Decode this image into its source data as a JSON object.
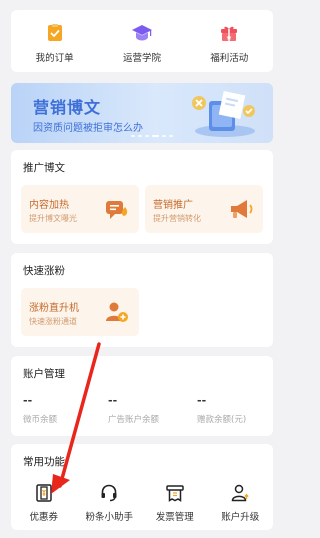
{
  "quick_links": [
    {
      "label": "我的订单",
      "icon": "order-check-icon",
      "color": "#f5a623"
    },
    {
      "label": "运营学院",
      "icon": "graduation-cap-icon",
      "color": "#7c5cf0"
    },
    {
      "label": "福利活动",
      "icon": "gift-box-icon",
      "color": "#f0505a"
    }
  ],
  "banner": {
    "title": "营销博文",
    "subtitle": "因资质问题被拒审怎么办"
  },
  "promote": {
    "title": "推广博文",
    "tiles": [
      {
        "title": "内容加热",
        "subtitle": "提升博文曝光",
        "icon": "chat-fire-icon"
      },
      {
        "title": "营销推广",
        "subtitle": "提升营销转化",
        "icon": "megaphone-icon"
      }
    ]
  },
  "followers": {
    "title": "快速涨粉",
    "tiles": [
      {
        "title": "涨粉直升机",
        "subtitle": "快速涨粉通道",
        "icon": "add-user-icon"
      }
    ]
  },
  "account": {
    "title": "账户管理",
    "items": [
      {
        "value": "--",
        "label": "微币余额"
      },
      {
        "value": "--",
        "label": "广告账户余额"
      },
      {
        "value": "--",
        "label": "赠款余额(元)"
      }
    ]
  },
  "tools": {
    "title": "常用功能",
    "items": [
      {
        "label": "优惠券",
        "icon": "coupon-icon"
      },
      {
        "label": "粉条小助手",
        "icon": "headset-icon"
      },
      {
        "label": "发票管理",
        "icon": "invoice-icon"
      },
      {
        "label": "账户升级",
        "icon": "user-upgrade-icon"
      }
    ]
  },
  "accent_color": "#f5a623",
  "annotation_color": "#e8261c"
}
